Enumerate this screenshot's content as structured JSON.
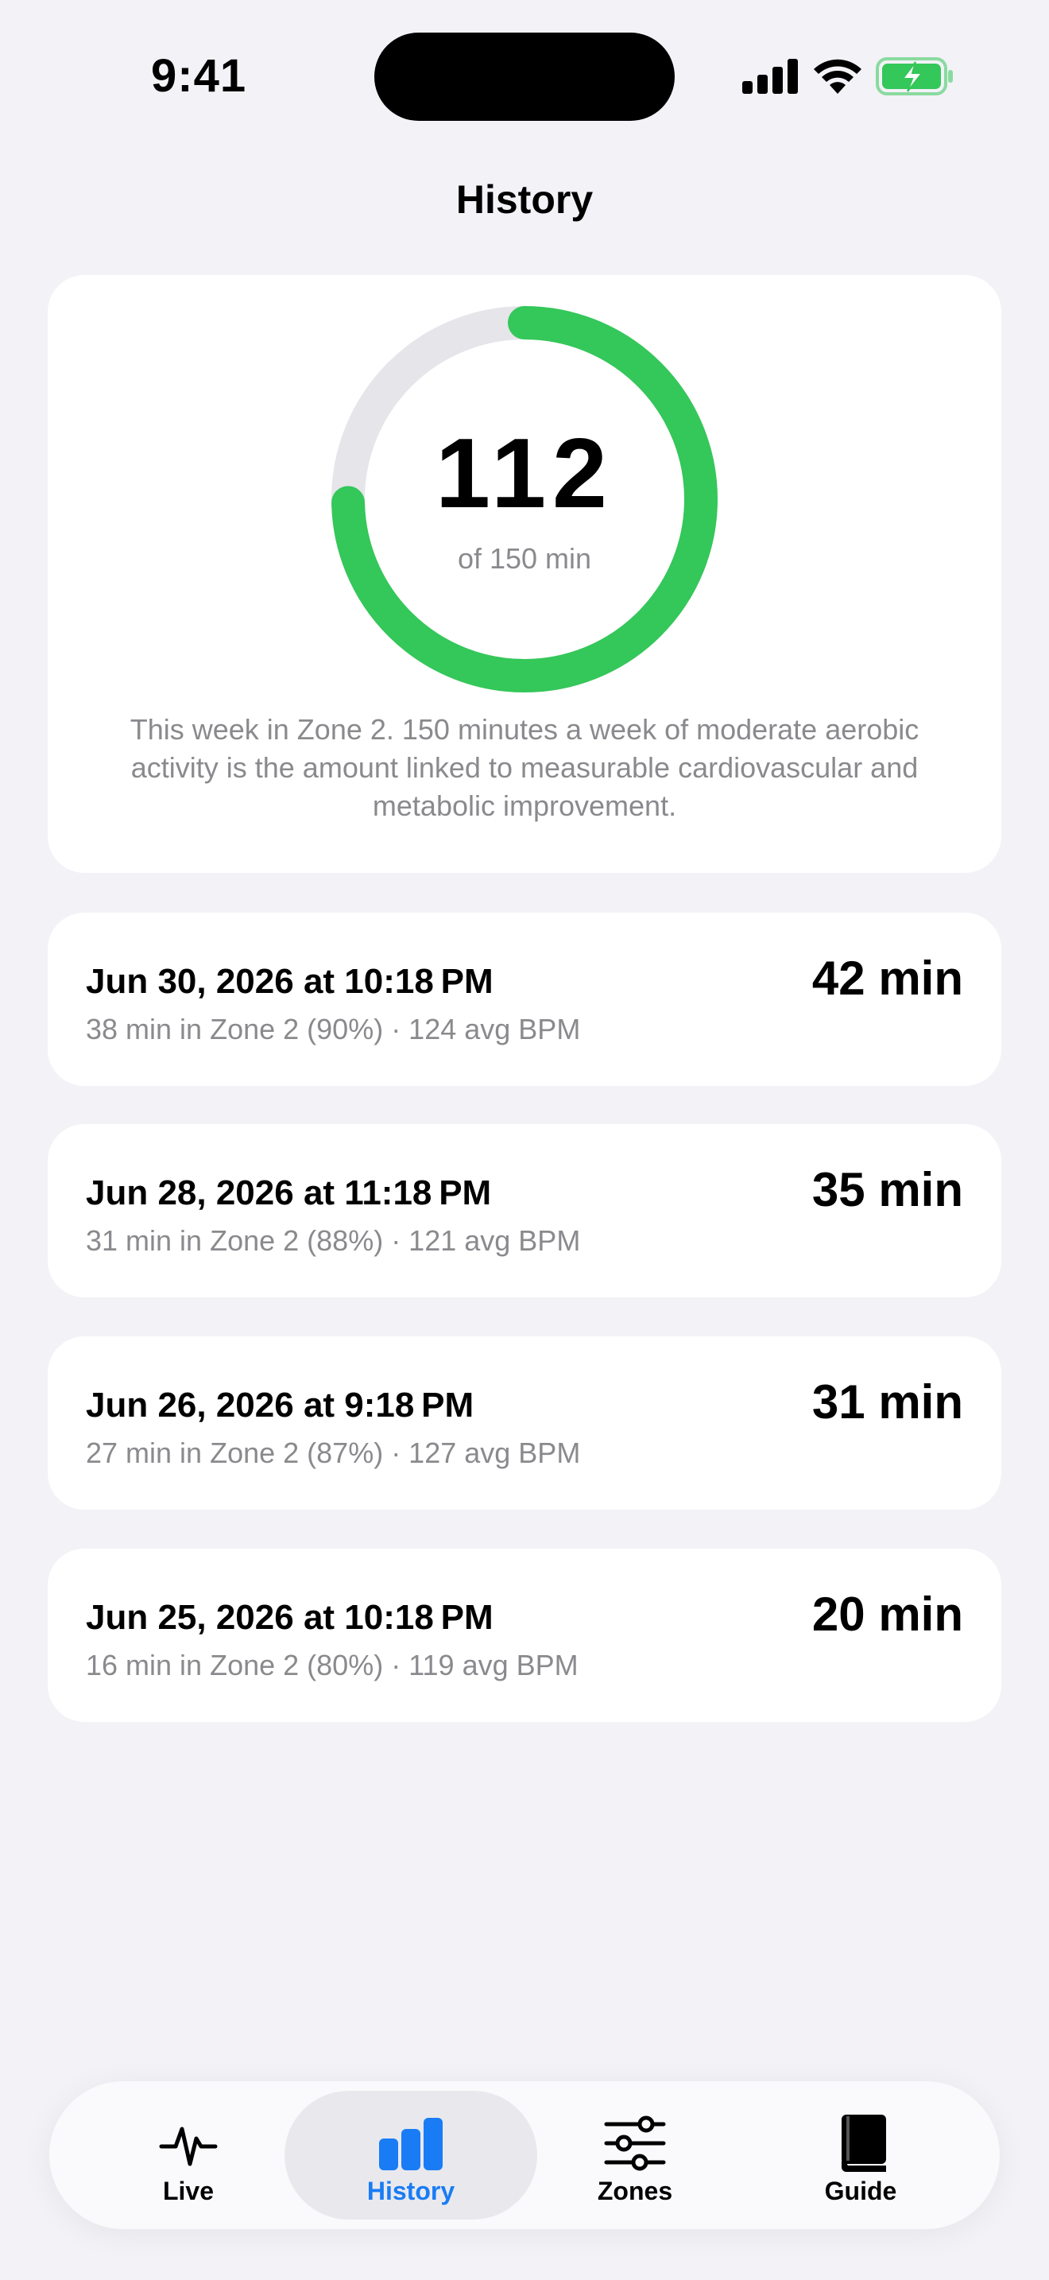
{
  "status_bar": {
    "time": "9:41"
  },
  "header": {
    "title": "History"
  },
  "summary": {
    "value": "112",
    "goal_label": "of 150 min",
    "progress": 0.7467,
    "ring_color": "#34C759",
    "track_color": "#E5E5EA",
    "description": "This week in Zone 2. 150 minutes a week of moderate aerobic activity is the amount linked to measurable cardiovascular and metabolic improvement."
  },
  "sessions": [
    {
      "date": "Jun 30, 2026 at 10:18 PM",
      "detail": "38 min in Zone 2 (90%) · 124 avg BPM",
      "duration": "42 min"
    },
    {
      "date": "Jun 28, 2026 at 11:18 PM",
      "detail": "31 min in Zone 2 (88%) · 121 avg BPM",
      "duration": "35 min"
    },
    {
      "date": "Jun 26, 2026 at 9:18 PM",
      "detail": "27 min in Zone 2 (87%) · 127 avg BPM",
      "duration": "31 min"
    },
    {
      "date": "Jun 25, 2026 at 10:18 PM",
      "detail": "16 min in Zone 2 (80%) · 119 avg BPM",
      "duration": "20 min"
    }
  ],
  "tabs": [
    {
      "label": "Live",
      "icon": "heartbeat-icon",
      "active": false
    },
    {
      "label": "History",
      "icon": "bar-chart-icon",
      "active": true
    },
    {
      "label": "Zones",
      "icon": "sliders-icon",
      "active": false
    },
    {
      "label": "Guide",
      "icon": "book-icon",
      "active": false
    }
  ],
  "colors": {
    "accent": "#1A7CF5",
    "ring": "#34C759",
    "battery": "#34C759"
  }
}
